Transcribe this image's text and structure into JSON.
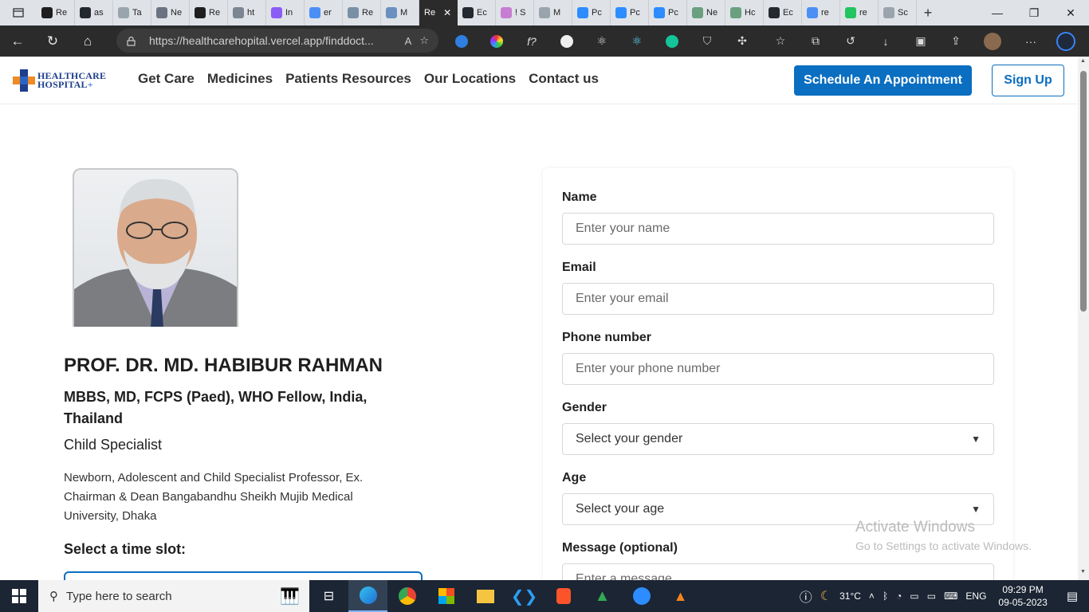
{
  "browser": {
    "tabs": [
      {
        "label": "Re",
        "color": "#1e1e1e"
      },
      {
        "label": "as",
        "color": "#24292f"
      },
      {
        "label": "Ta",
        "color": "#9aa4ad"
      },
      {
        "label": "Ne",
        "color": "#6b7280"
      },
      {
        "label": "Re",
        "color": "#1e1e1e"
      },
      {
        "label": "ht",
        "color": "#7c8692"
      },
      {
        "label": "In",
        "color": "#8b5cf6"
      },
      {
        "label": "er",
        "color": "#4b8ff5"
      },
      {
        "label": "Re",
        "color": "#7a8fa6"
      },
      {
        "label": "M",
        "color": "#6b8fbf"
      }
    ],
    "active_tab": {
      "label": "Re"
    },
    "tabs_right": [
      {
        "label": "Ec",
        "color": "#24292f"
      },
      {
        "label": "! S",
        "color": "#c77dd1"
      },
      {
        "label": "M",
        "color": "#9aa4ad"
      },
      {
        "label": "Pc",
        "color": "#2d8cff"
      },
      {
        "label": "Pc",
        "color": "#2d8cff"
      },
      {
        "label": "Pc",
        "color": "#2d8cff"
      },
      {
        "label": "Ne",
        "color": "#6aa07f"
      },
      {
        "label": "Hc",
        "color": "#6aa07f"
      },
      {
        "label": "Ec",
        "color": "#24292f"
      },
      {
        "label": "re",
        "color": "#4b8ff5"
      },
      {
        "label": "re",
        "color": "#22c55e"
      },
      {
        "label": "Sc",
        "color": "#9aa4ad"
      }
    ],
    "url_host": "https://healthcarehopital.vercel.app",
    "url_path": "/finddoct..."
  },
  "site": {
    "logo_line1": "HEALTHCARE",
    "logo_line2": "HOSPITAL",
    "logo_plus": "+",
    "nav": [
      "Get Care",
      "Medicines",
      "Patients Resources",
      "Our Locations",
      "Contact us"
    ],
    "appointment_button": "Schedule An Appointment",
    "signup_button": "Sign Up"
  },
  "doctor": {
    "name": "PROF. DR. MD. HABIBUR RAHMAN",
    "degrees": "MBBS, MD, FCPS (Paed), WHO Fellow, India, Thailand",
    "specialty": "Child Specialist",
    "description": "Newborn, Adolescent and Child Specialist Professor, Ex. Chairman & Dean Bangabandhu Sheikh Mujib Medical University, Dhaka",
    "slot_label": "Select a time slot:"
  },
  "form": {
    "name_label": "Name",
    "name_placeholder": "Enter your name",
    "email_label": "Email",
    "email_placeholder": "Enter your email",
    "phone_label": "Phone number",
    "phone_placeholder": "Enter your phone number",
    "gender_label": "Gender",
    "gender_value": "Select your gender",
    "age_label": "Age",
    "age_value": "Select your age",
    "message_label": "Message (optional)",
    "message_placeholder": "Enter a message"
  },
  "watermark": {
    "line1": "Activate Windows",
    "line2": "Go to Settings to activate Windows."
  },
  "taskbar": {
    "search_placeholder": "Type here to search",
    "weather": "31°C",
    "language": "ENG",
    "time": "09:29 PM",
    "date": "09-05-2023"
  }
}
